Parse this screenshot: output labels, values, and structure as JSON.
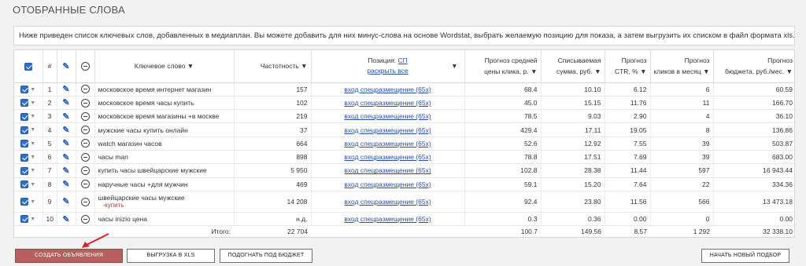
{
  "page": {
    "title": "ОТОБРАННЫЕ СЛОВА",
    "notice": "Ниже приведен список ключевых слов, добавленных в медиаплан. Вы можете добавить для них минус-слова на основе Wordstat, выбрать желаемую позицию для показа, а затем выгрузить их списком в файл формата xls."
  },
  "table": {
    "headers": {
      "num": "#",
      "keyword": "Ключевое слово ▼",
      "frequency": "Частотность ▼",
      "position_label": "Позиция:",
      "position_value": "СП",
      "expand_all": "раскрыть все",
      "position_caret": "▼",
      "forecast_price_1": "Прогноз средней",
      "forecast_price_2": "цены клика, р. ▼",
      "charged_1": "Списываемая",
      "charged_2": "сумма, руб. ▼",
      "ctr_1": "Прогноз",
      "ctr_2": "CTR, % ▼",
      "clicks_1": "Прогноз",
      "clicks_2": "кликов в месяц ▼",
      "budget_1": "Прогноз",
      "budget_2": "бюджета, руб./мес. ▼"
    },
    "rows": [
      {
        "n": "1",
        "keyword": "московское время интернет магазин",
        "minus": "",
        "freq": "157",
        "position": "вход спецразмещение (65x)",
        "price": "68.4",
        "charged": "10.10",
        "ctr": "6.12",
        "clicks": "6",
        "budget": "60.59"
      },
      {
        "n": "2",
        "keyword": "московское время часы купить",
        "minus": "",
        "freq": "102",
        "position": "вход спецразмещение (65x)",
        "price": "45.0",
        "charged": "15.15",
        "ctr": "11.76",
        "clicks": "11",
        "budget": "166.70"
      },
      {
        "n": "3",
        "keyword": "московское время магазины +в москве",
        "minus": "",
        "freq": "219",
        "position": "вход спецразмещение (65x)",
        "price": "78.5",
        "charged": "9.03",
        "ctr": "2.90",
        "clicks": "4",
        "budget": "36.10"
      },
      {
        "n": "4",
        "keyword": "мужские часы купить онлайн",
        "minus": "",
        "freq": "37",
        "position": "вход спецразмещение (65x)",
        "price": "429.4",
        "charged": "17.11",
        "ctr": "19.05",
        "clicks": "8",
        "budget": "136.86"
      },
      {
        "n": "5",
        "keyword": "watch магазин часов",
        "minus": "",
        "freq": "664",
        "position": "вход спецразмещение (65x)",
        "price": "52.6",
        "charged": "12.92",
        "ctr": "7.55",
        "clicks": "39",
        "budget": "503.87"
      },
      {
        "n": "6",
        "keyword": "часы man",
        "minus": "",
        "freq": "898",
        "position": "вход спецразмещение (65x)",
        "price": "78.8",
        "charged": "17.51",
        "ctr": "7.69",
        "clicks": "39",
        "budget": "683.00"
      },
      {
        "n": "7",
        "keyword": "купить часы швейцарские мужские",
        "minus": "",
        "freq": "5 950",
        "position": "вход спецразмещение (65x)",
        "price": "102.8",
        "charged": "28.38",
        "ctr": "11.44",
        "clicks": "597",
        "budget": "16 943.44"
      },
      {
        "n": "8",
        "keyword": "наручные часы +для мужчин",
        "minus": "",
        "freq": "469",
        "position": "вход спецразмещение (65x)",
        "price": "59.1",
        "charged": "15.20",
        "ctr": "7.64",
        "clicks": "22",
        "budget": "334.36"
      },
      {
        "n": "9",
        "keyword": "швейцарские часы мужские",
        "minus": "-купить",
        "freq": "14 208",
        "position": "вход спецразмещение (65x)",
        "price": "92.4",
        "charged": "23.80",
        "ctr": "11.56",
        "clicks": "566",
        "budget": "13 473.18"
      },
      {
        "n": "10",
        "keyword": "часы inizio цена",
        "minus": "",
        "freq": "н.д.",
        "position": "вход спецразмещение (65x)",
        "price": "0.3",
        "charged": "0.36",
        "ctr": "0.00",
        "clicks": "0",
        "budget": "0.00"
      }
    ],
    "totals": {
      "label": "Итого:",
      "freq": "22 704",
      "price": "100.7",
      "charged": "149.56",
      "ctr": "8.57",
      "clicks": "1 292",
      "budget": "32 338.10"
    }
  },
  "buttons": {
    "create_ads": "СОЗДАТЬ ОБЪЯВЛЕНИЯ",
    "export_xls": "ВЫГРУЗКА В XLS",
    "fit_budget": "ПОДОГНАТЬ ПОД БЮДЖЕТ",
    "new_selection": "НАЧАТЬ НОВЫЙ ПОДБОР"
  },
  "colors": {
    "accent": "#2e6fc9",
    "primary_button": "#b85e5e",
    "link": "#2a4f9e",
    "minus_word": "#b23434",
    "annotation_arrow": "#d0262a"
  }
}
